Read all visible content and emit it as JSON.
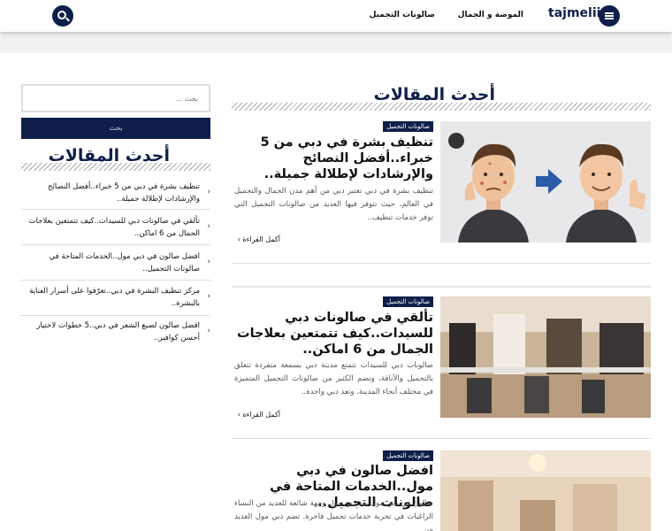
{
  "header": {
    "logo": "tajmelii",
    "nav": [
      "الموضة و الجمال",
      "صالونات التجميل"
    ]
  },
  "main": {
    "section_title": "أحدث المقالات",
    "read_more": "أكمل القراءة ›",
    "articles": [
      {
        "category": "صالونات التجميل",
        "title": "تنظيف بشرة في دبي من 5 خبراء..أفضل النصائح والإرشادات لإطلالة جميلة..",
        "excerpt": "تنظيف بشرة في دبي تعتبر دبي من أهم مدن الجمال والتجميل في العالم، حيث تتوفر فيها العديد من صالونات التجميل التي توفر خدمات تنظيف.."
      },
      {
        "category": "صالونات التجميل",
        "title": "تألقي في صالونات دبي للسيدات..كيف تتمتعين بعلاجات الجمال من 6 اماكن..",
        "excerpt": "صالونات دبي للسيدات تتمتع مدينة دبي بسمعة متفردة تتعلق بالتجميل والأناقة، وتضم الكثير من صالونات التجميل المتميزة في مختلف أنحاء المدينة. وتعد دبي واحدة.."
      },
      {
        "category": "صالونات التجميل",
        "title": "افضل صالون في دبي مول..الخدمات المتاحة في صالونات التجميل..",
        "excerpt": "صالون في دبي مول يعد دبي مول وجهة شائعة للعديد من النساء الراغبات في تجربة خدمات تجميل فاخرة. تضم دبي مول العديد من"
      }
    ]
  },
  "sidebar": {
    "search_placeholder": "بحث ...",
    "search_button": "بحث",
    "section_title": "أحدث المقالات",
    "items": [
      "تنظيف بشرة في دبي من 5 خبراء..أفضل النصائح والإرشادات لإطلالة جميلة..",
      "تألقي في صالونات دبي للسيدات..كيف تتمتعين بعلاجات الجمال من 6 اماكن..",
      "افضل صالون في دبي مول..الخدمات المتاحة في صالونات التجميل..",
      "مركز تنظيف البشرة في دبي..تعرّفوا على أسرار العناية بالبشرة..",
      "افضل صالون لصبغ الشعر في دبي..5 خطوات لاختيار أحسن كوافير.."
    ]
  },
  "colors": {
    "navy": "#0f1f4b",
    "badge": "#0f1f4b"
  }
}
